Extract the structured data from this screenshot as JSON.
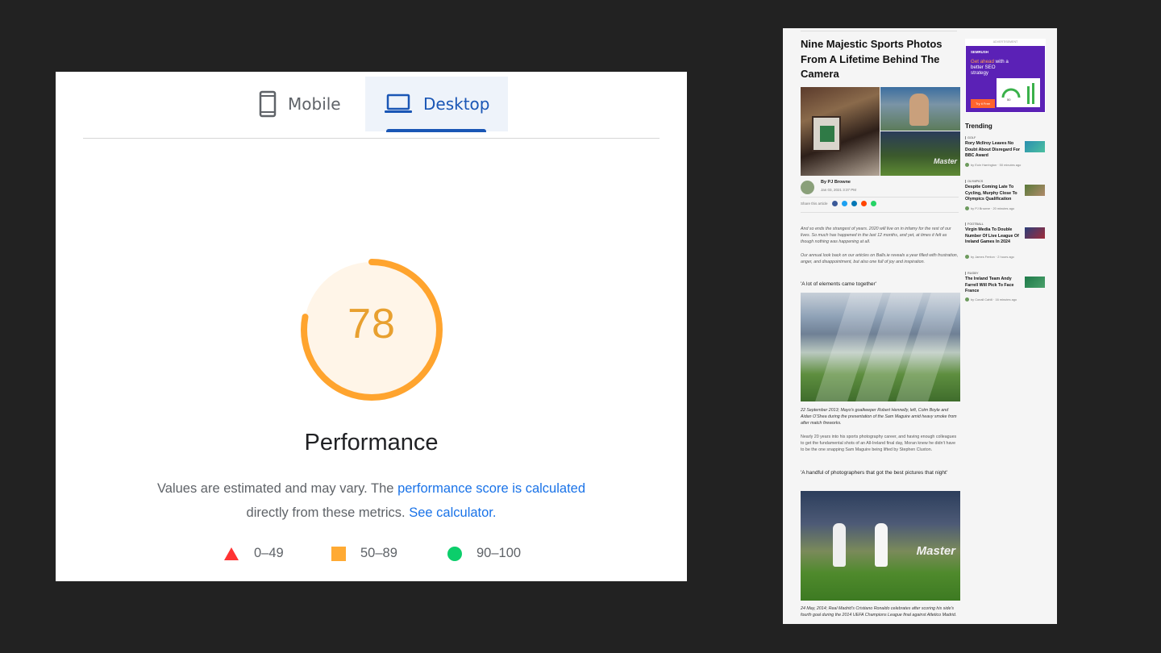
{
  "pagespeed": {
    "tabs": [
      {
        "label": "Mobile",
        "icon": "phone-icon",
        "selected": false
      },
      {
        "label": "Desktop",
        "icon": "laptop-icon",
        "selected": true
      }
    ],
    "score": "78",
    "score_fraction": 0.78,
    "score_color": "#ffa400",
    "metric_title": "Performance",
    "description": {
      "text_1": "Values are estimated and may vary. The ",
      "link_1": "performance score is calculated",
      "text_2": "directly from these metrics. ",
      "link_2": "See calculator."
    },
    "legend": [
      {
        "range": "0–49",
        "shape": "triangle",
        "color": "#ff3333"
      },
      {
        "range": "50–89",
        "shape": "square",
        "color": "#ffaa33"
      },
      {
        "range": "90–100",
        "shape": "circle",
        "color": "#0cce6b"
      }
    ]
  },
  "article": {
    "title": "Nine Majestic Sports Photos From A Lifetime Behind The Camera",
    "author": "By PJ Browne",
    "date": "Jan 03, 2021 3:37 PM",
    "share_label": "Share this article",
    "share_colors": [
      "#3b5998",
      "#1da1f2",
      "#0077b5",
      "#ff4500",
      "#25d366"
    ],
    "paragraphs": [
      "And so ends the strangest of years. 2020 will live on in infamy for the rest of our lives. So much has happened in the last 12 months, and yet, at times it felt as though nothing was happening at all.",
      "Our annual look back on our articles on Balls.ie reveals a year filled with frustration, anger, and disappointment, but also one full of joy and inspiration."
    ],
    "heading_1": "'A lot of elements came together'",
    "caption_1": "22 September 2013; Mayo's goalkeeper Robert Hennelly, left, Colm Boyle and Aidan O'Shea during the presentation of the Sam Maguire amid heavy smoke from after match fireworks.",
    "body_1": "Nearly 20 years into his sports photography career, and having enough colleagues to get the fundamental shots of an All-Ireland final day, Moran knew he didn't have to be the one snapping Sam Maguire being lifted by Stephen Cluxton.",
    "heading_2": "'A handful of photographers that got the best pictures that night'",
    "caption_2": "24 May, 2014; Real Madrid's Cristiano Ronaldo celebrates after scoring his side's fourth goal during the 2014 UEFA Champions League final against Atletico Madrid.",
    "hero_brand": "Master",
    "photo_brand": "Master",
    "ad": {
      "label": "ADVERTISEMENT",
      "brand": "SEMRUSH",
      "copy_highlight": "Get ahead",
      "copy_rest": " with a better SEO strategy",
      "cta": "Try it Free",
      "score": "50"
    },
    "trending_title": "Trending",
    "trending": [
      {
        "category": "GOLF",
        "title": "Rory McIlroy Leaves No Doubt About Disregard For BBC Award",
        "byline": "by Eoin Harrington · 50 minutes ago"
      },
      {
        "category": "OLYMPICS",
        "title": "Despite Coming Late To Cycling, Murphy Close To Olympics Qualification",
        "byline": "by PJ Browne · 20 minutes ago"
      },
      {
        "category": "FOOTBALL",
        "title": "Virgin Media To Double Number Of Live League Of Ireland Games In 2024",
        "byline": "by James Fenton · 2 hours ago"
      },
      {
        "category": "RUGBY",
        "title": "The Ireland Team Andy Farrell Will Pick To Face France",
        "byline": "by Conall Cahill · 16 minutes ago"
      }
    ]
  }
}
